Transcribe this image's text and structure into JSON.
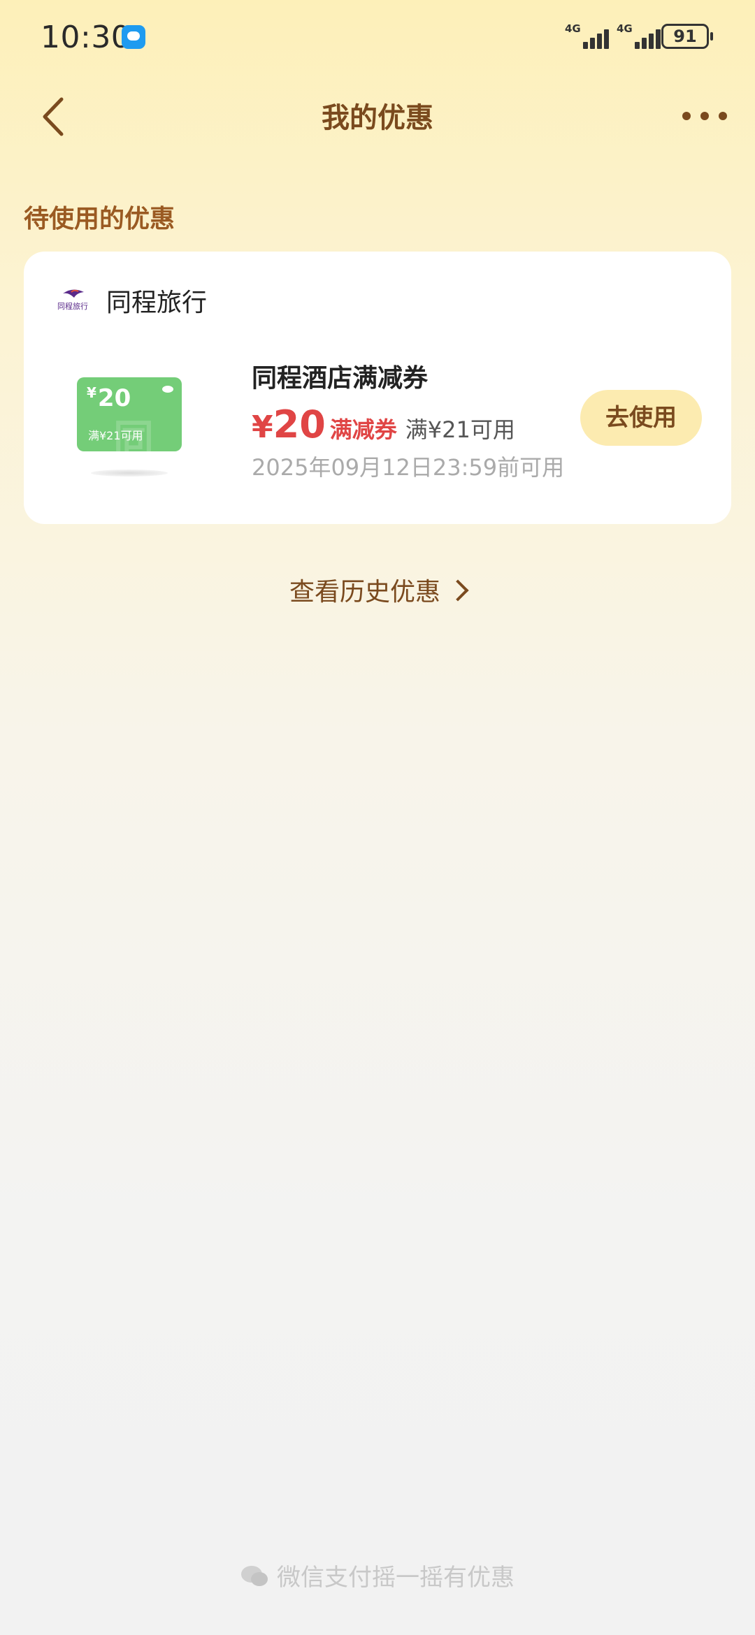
{
  "status": {
    "time": "10:30",
    "network_1": "4G",
    "network_2": "4G",
    "battery": "91"
  },
  "nav": {
    "title": "我的优惠",
    "back_icon": "chevron-left-icon",
    "more_icon": "more-horizontal-icon"
  },
  "section": {
    "title": "待使用的优惠"
  },
  "card": {
    "brand_name": "同程旅行",
    "brand_logo_text": "同程旅行",
    "coupon_name": "同程酒店满减券",
    "currency": "¥",
    "amount": "20",
    "type": "满减券",
    "condition": "满¥21可用",
    "expiry": "2025年09月12日23:59前可用",
    "use_label": "去使用",
    "thumb": {
      "currency": "¥",
      "amount": "20",
      "condition": "满¥21可用",
      "watermark": "同程"
    }
  },
  "history": {
    "label": "查看历史优惠"
  },
  "footer": {
    "text": "微信支付摇一摇有优惠"
  },
  "colors": {
    "accent_brown": "#7a4a1e",
    "price_red": "#e04545",
    "button_bg": "#fcebb0",
    "coupon_green": "#74cd78"
  }
}
